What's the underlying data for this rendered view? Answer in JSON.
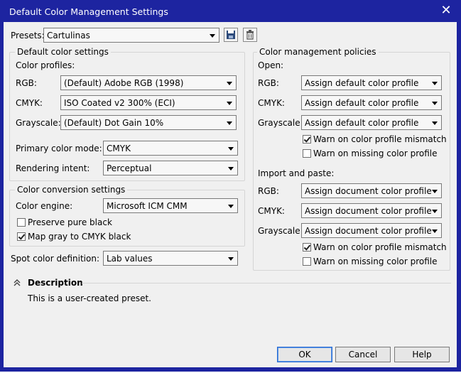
{
  "window": {
    "title": "Default Color Management Settings"
  },
  "presets": {
    "label": "Presets:",
    "value": "Cartulinas"
  },
  "default_color_settings": {
    "title": "Default color settings",
    "profiles_heading": "Color profiles:",
    "rgb": {
      "label": "RGB:",
      "value": "(Default) Adobe RGB (1998)"
    },
    "cmyk": {
      "label": "CMYK:",
      "value": "ISO Coated v2 300% (ECI)"
    },
    "grayscale": {
      "label": "Grayscale:",
      "value": "(Default) Dot Gain 10%"
    },
    "primary_mode": {
      "label": "Primary color mode:",
      "value": "CMYK"
    },
    "rendering_intent": {
      "label": "Rendering intent:",
      "value": "Perceptual"
    }
  },
  "conversion": {
    "title": "Color conversion settings",
    "engine": {
      "label": "Color engine:",
      "value": "Microsoft ICM CMM"
    },
    "preserve_black": {
      "label": "Preserve pure black",
      "checked": false
    },
    "map_gray": {
      "label": "Map gray to CMYK black",
      "checked": true
    }
  },
  "spot": {
    "label": "Spot color definition:",
    "value": "Lab values"
  },
  "policies": {
    "title": "Color management policies",
    "open": {
      "heading": "Open:",
      "rgb": {
        "label": "RGB:",
        "value": "Assign default color profile"
      },
      "cmyk": {
        "label": "CMYK:",
        "value": "Assign default color profile"
      },
      "grayscale": {
        "label": "Grayscale:",
        "value": "Assign default color profile"
      },
      "warn_mismatch": {
        "label": "Warn on color profile mismatch",
        "checked": true
      },
      "warn_missing": {
        "label": "Warn on missing color profile",
        "checked": false
      }
    },
    "import": {
      "heading": "Import and paste:",
      "rgb": {
        "label": "RGB:",
        "value": "Assign document color profile"
      },
      "cmyk": {
        "label": "CMYK:",
        "value": "Assign document color profile"
      },
      "grayscale": {
        "label": "Grayscale:",
        "value": "Assign document color profile"
      },
      "warn_mismatch": {
        "label": "Warn on color profile mismatch",
        "checked": true
      },
      "warn_missing": {
        "label": "Warn on missing color profile",
        "checked": false
      }
    }
  },
  "description": {
    "heading": "Description",
    "text": "This is a user-created preset."
  },
  "buttons": {
    "ok": "OK",
    "cancel": "Cancel",
    "help": "Help"
  }
}
